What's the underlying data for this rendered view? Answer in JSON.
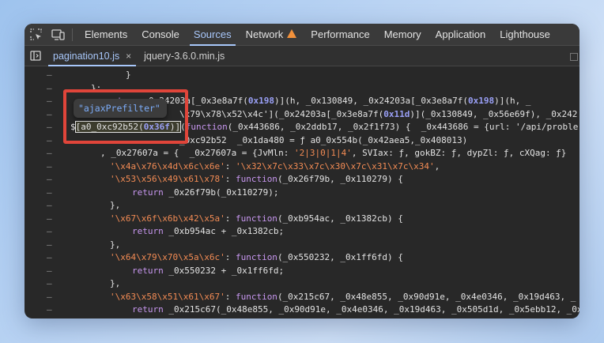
{
  "toolbar": {
    "tabs": [
      "Elements",
      "Console",
      "Sources",
      "Network",
      "Performance",
      "Memory",
      "Application",
      "Lighthouse"
    ],
    "active_tab": "Sources",
    "network_warning": true
  },
  "filetabs": {
    "active": "pagination10.js",
    "other": "jquery-3.6.0.min.js",
    "close": "×"
  },
  "tooltip": "\"ajaxPrefilter\"",
  "gutter_mark": "–",
  "code_lines": [
    {
      "t": "}"
    },
    {
      "t": "};"
    },
    {
      "t": "return _0x24203a[_0x3e8a7f(0x198)](h, _0x130849, _0x24203a[_0x3e8a7f(0x198)](h, _"
    },
    {
      "t": "\\x79\\x78\\x52\\x4c'](_0x24203a[_0x3e8a7f(0x11d)](_0x130849, _0x56e69f), _0x242"
    },
    {
      "t": "$[a0_0xc92b52(0x36f)](function(_0x443686, _0x2ddb17, _0x2f1f73) {  _0x443686 = {url: '/api/proble"
    },
    {
      "t": "_0xc92b52  _0x1da480 = ƒ a0_0x554b(_0x42aea5,_0x408013)"
    },
    {
      "t": ", _0x27607a = {  _0x27607a = {JvMln: '2|3|0|1|4', SVIax: ƒ, gokBZ: ƒ, dypZl: ƒ, cXQag: ƒ}"
    },
    {
      "t": "'\\x4a\\x76\\x4d\\x6c\\x6e': '\\x32\\x7c\\x33\\x7c\\x30\\x7c\\x31\\x7c\\x34',"
    },
    {
      "t": "'\\x53\\x56\\x49\\x61\\x78': function(_0x26f79b, _0x110279) {"
    },
    {
      "t": "return _0x26f79b(_0x110279);"
    },
    {
      "t": "},"
    },
    {
      "t": "'\\x67\\x6f\\x6b\\x42\\x5a': function(_0xb954ac, _0x1382cb) {"
    },
    {
      "t": "return _0xb954ac + _0x1382cb;"
    },
    {
      "t": "},"
    },
    {
      "t": "'\\x64\\x79\\x70\\x5a\\x6c': function(_0x550232, _0x1ff6fd) {"
    },
    {
      "t": "return _0x550232 + _0x1ff6fd;"
    },
    {
      "t": "},"
    },
    {
      "t": "'\\x63\\x58\\x51\\x61\\x67': function(_0x215c67, _0x48e855, _0x90d91e, _0x4e0346, _0x19d463, _"
    },
    {
      "t": "return _0x215c67(_0x48e855, _0x90d91e, _0x4e0346, _0x19d463, _0x505d1d, _0x5ebb12, _0x"
    },
    {
      "t": "}"
    }
  ],
  "colors": {
    "accent": "#a8c7fa",
    "highlight_box": "#e0453a",
    "warning": "#f2913b"
  }
}
